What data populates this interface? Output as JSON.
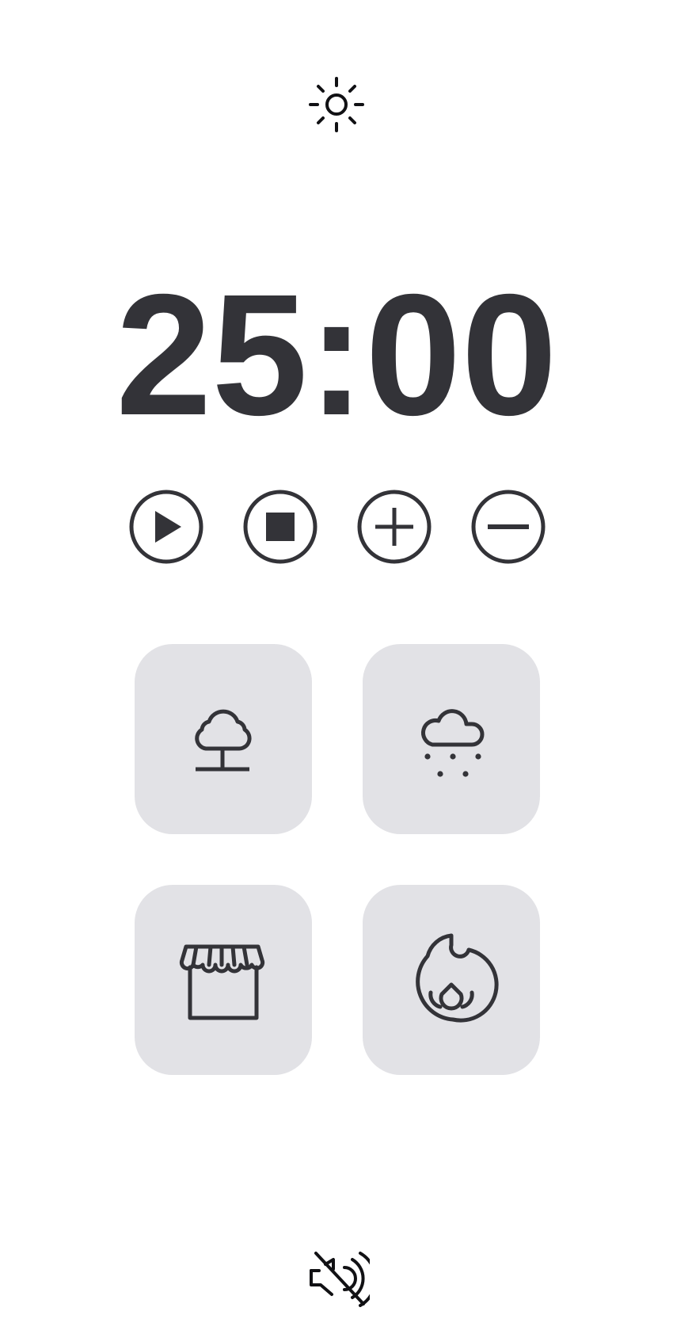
{
  "timer": {
    "display": "25:00"
  },
  "header": {
    "theme_icon": "sun-icon"
  },
  "controls": [
    {
      "name": "play",
      "icon": "play-circle-icon"
    },
    {
      "name": "stop",
      "icon": "stop-circle-icon"
    },
    {
      "name": "increase",
      "icon": "plus-circle-icon"
    },
    {
      "name": "decrease",
      "icon": "minus-circle-icon"
    }
  ],
  "sounds": [
    {
      "name": "forest",
      "icon": "tree-icon"
    },
    {
      "name": "rain",
      "icon": "cloud-rain-icon"
    },
    {
      "name": "cafe",
      "icon": "storefront-icon"
    },
    {
      "name": "fire",
      "icon": "flame-icon"
    }
  ],
  "footer": {
    "sound_icon": "speaker-muted-icon"
  },
  "colors": {
    "background": "#ffffff",
    "foreground": "#333338",
    "tile": "#e2e2e6"
  }
}
